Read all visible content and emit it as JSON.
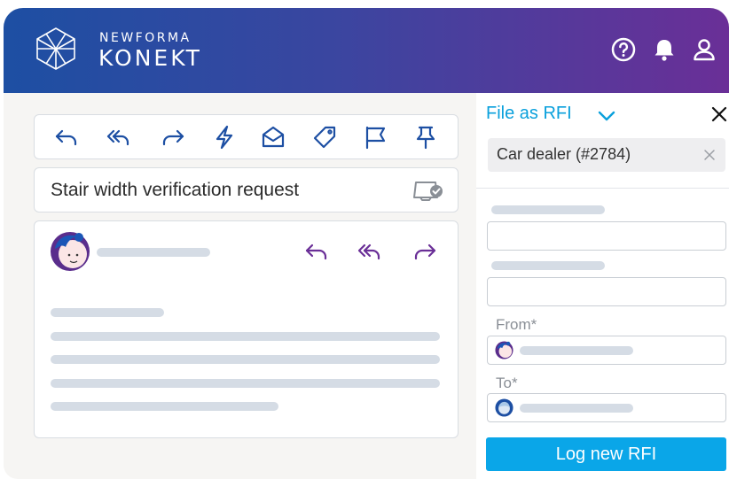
{
  "header": {
    "brand_top": "NEWFORMA",
    "brand_main": "KONEKT",
    "icons": [
      "help-icon",
      "bell-icon",
      "user-icon"
    ]
  },
  "toolbar": {
    "icons": [
      "reply-icon",
      "reply-all-icon",
      "forward-icon",
      "lightning-icon",
      "mark-read-icon",
      "tag-icon",
      "flag-icon",
      "pin-icon"
    ]
  },
  "email": {
    "subject": "Stair width verification request",
    "actions": [
      "reply-icon",
      "reply-all-icon",
      "forward-icon"
    ]
  },
  "panel": {
    "title": "File as RFI",
    "project_tag": "Car dealer (#2784)",
    "from_label": "From*",
    "to_label": "To*",
    "submit_label": "Log new RFI"
  },
  "colors": {
    "accent": "#0aa6e8",
    "purple": "#6a2f97",
    "header_start": "#1d4fa3",
    "header_end": "#6a2f97",
    "placeholder": "#d5dce5"
  }
}
